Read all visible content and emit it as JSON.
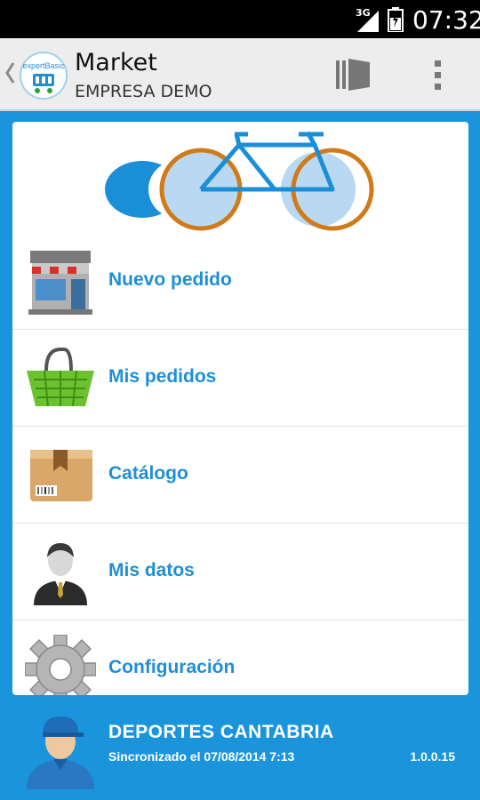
{
  "status_bar": {
    "network": "3G",
    "time": "07:32"
  },
  "action_bar": {
    "logo_text": "expertBasic",
    "title": "Market",
    "subtitle": "EMPRESA DEMO",
    "icons": [
      "back-chevron-icon",
      "app-logo-icon",
      "panel-toggle-icon",
      "overflow-menu-icon"
    ]
  },
  "menu": {
    "items": [
      {
        "label": "Nuevo pedido",
        "icon": "storefront-icon"
      },
      {
        "label": "Mis pedidos",
        "icon": "basket-icon"
      },
      {
        "label": "Catálogo",
        "icon": "box-icon"
      },
      {
        "label": "Mis datos",
        "icon": "user-suit-icon"
      },
      {
        "label": "Configuración",
        "icon": "gear-icon"
      }
    ]
  },
  "footer": {
    "company": "DEPORTES CANTABRIA",
    "sync": "Sincronizado el 07/08/2014 7:13",
    "version": "1.0.0.15"
  },
  "colors": {
    "accent": "#1a95dc",
    "label_blue": "#1e8fd6",
    "bike_orange": "#d07a1a",
    "action_bar": "#ededed"
  }
}
